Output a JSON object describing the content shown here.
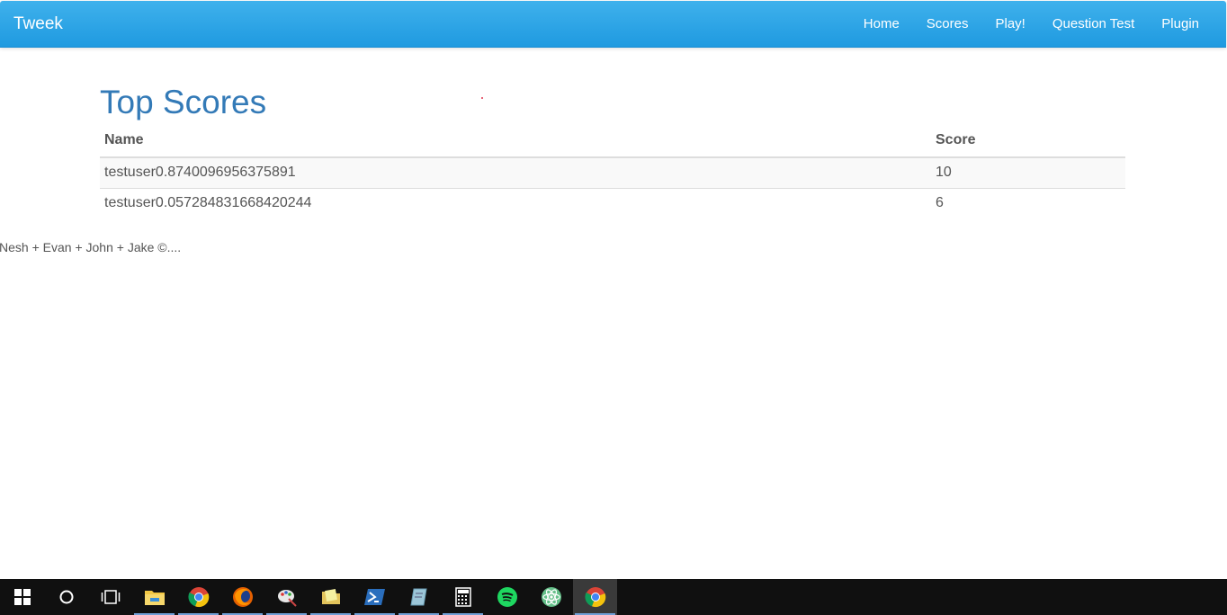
{
  "navbar": {
    "brand": "Tweek",
    "links": [
      "Home",
      "Scores",
      "Play!",
      "Question Test",
      "Plugin"
    ],
    "color": "#2aa4e8"
  },
  "main": {
    "title": "Top Scores",
    "table": {
      "headers": [
        "Name",
        "Score"
      ],
      "rows": [
        [
          "testuser0.8740096956375891",
          "10"
        ],
        [
          "testuser0.057284831668420244",
          "6"
        ]
      ]
    }
  },
  "footer": {
    "text": "Nesh + Evan + John + Jake ©...."
  },
  "taskbar": {
    "items": [
      {
        "icon": "windows-start-icon",
        "running": false
      },
      {
        "icon": "cortana-icon",
        "running": false
      },
      {
        "icon": "task-view-icon",
        "running": false
      },
      {
        "icon": "file-explorer-icon",
        "running": true
      },
      {
        "icon": "chrome-icon",
        "running": true
      },
      {
        "icon": "firefox-icon",
        "running": true
      },
      {
        "icon": "paint-icon",
        "running": true
      },
      {
        "icon": "folder-notes-icon",
        "running": true
      },
      {
        "icon": "powershell-icon",
        "running": true
      },
      {
        "icon": "pdf-icon",
        "running": true
      },
      {
        "icon": "calculator-icon",
        "running": true
      },
      {
        "icon": "spotify-icon",
        "running": false
      },
      {
        "icon": "atom-icon",
        "running": false
      },
      {
        "icon": "chrome-active-icon",
        "running": true,
        "active": true
      }
    ]
  }
}
